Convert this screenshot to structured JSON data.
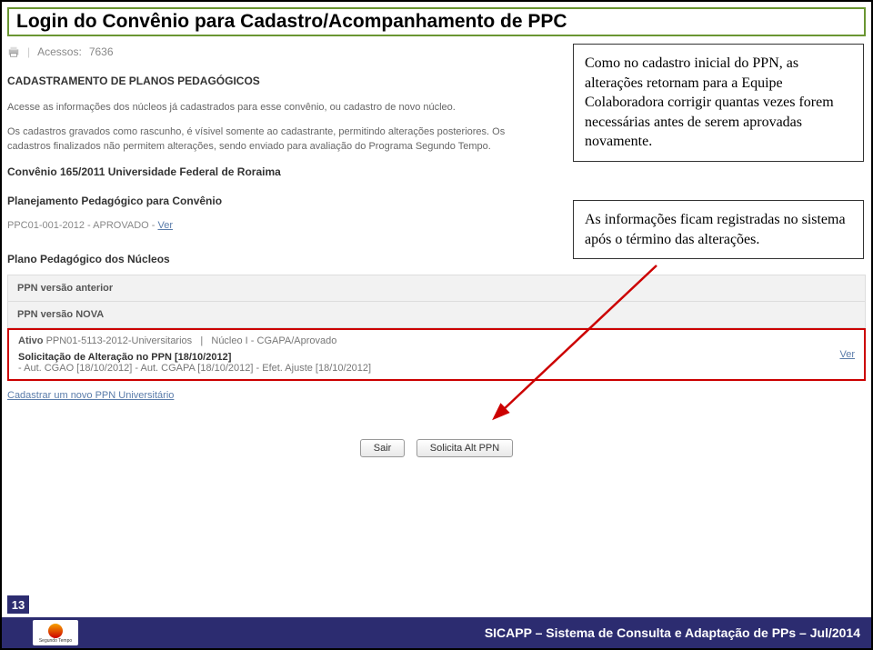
{
  "title": "Login do Convênio para Cadastro/Acompanhamento de PPC",
  "access": {
    "label": "Acessos:",
    "count": "7636"
  },
  "section_title": "CADASTRAMENTO DE PLANOS PEDAGÓGICOS",
  "body1": "Acesse as informações dos núcleos já cadastrados para esse convênio, ou cadastro de novo núcleo.",
  "body2": "Os cadastros gravados como rascunho, é vísivel somente ao cadastrante, permitindo alterações posteriores. Os cadastros finalizados não permitem alterações, sendo enviado para avaliação do Programa Segundo Tempo.",
  "convenio": "Convênio 165/2011 Universidade Federal de Roraima",
  "planejamento": "Planejamento Pedagógico para Convênio",
  "ppc_status": "PPC01-001-2012 - APROVADO -",
  "ver": "Ver",
  "plano_title": "Plano Pedagógico dos Núcleos",
  "version_anterior": "PPN versão anterior",
  "version_nova": "PPN versão NOVA",
  "ativo": {
    "label": "Ativo",
    "code": "PPN01-5113-2012-Universitarios",
    "sep": "|",
    "nucleo": "Núcleo I - CGAPA/Aprovado",
    "solic": "Solicitação de Alteração no PPN [18/10/2012]",
    "aut": "- Aut. CGAO [18/10/2012] - Aut. CGAPA [18/10/2012] - Efet. Ajuste [18/10/2012]"
  },
  "cadastrar": "Cadastrar um novo PPN Universitário",
  "btn_sair": "Sair",
  "btn_solic": "Solicita Alt PPN",
  "callout1": "Como no cadastro inicial do PPN, as alterações retornam para a Equipe Colaboradora corrigir quantas vezes forem necessárias antes de serem aprovadas novamente.",
  "callout2": "As informações ficam registradas no sistema após o término das alterações.",
  "page_num": "13",
  "logo_text": "Segundo Tempo",
  "footer": "SICAPP – Sistema de Consulta e Adaptação de PPs – Jul/2014"
}
